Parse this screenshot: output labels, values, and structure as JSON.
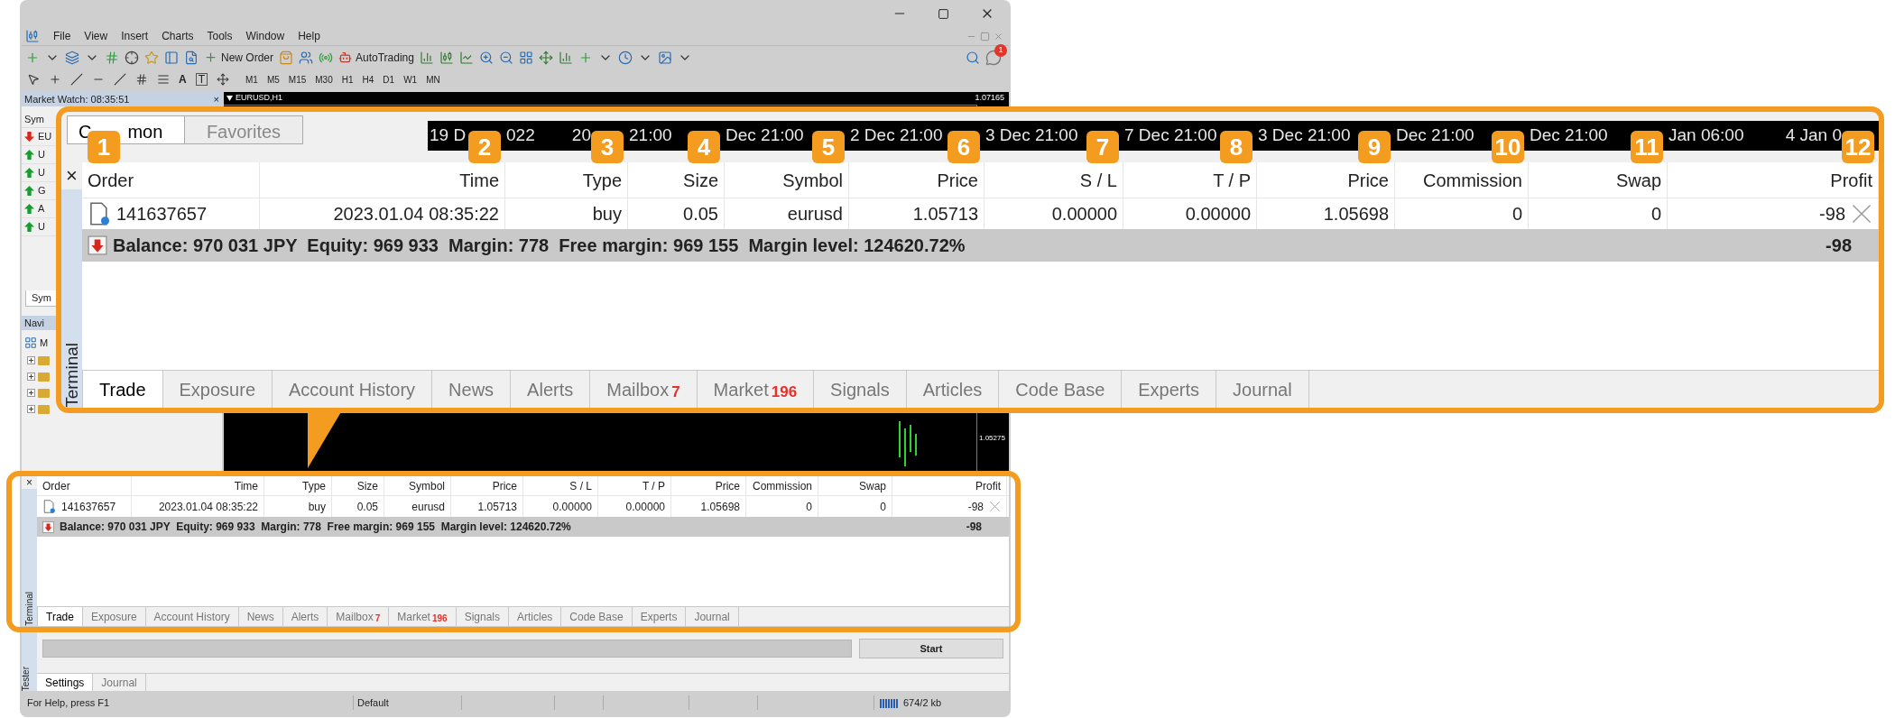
{
  "window": {
    "menu": [
      "File",
      "View",
      "Insert",
      "Charts",
      "Tools",
      "Window",
      "Help"
    ]
  },
  "toolbar": {
    "buttons": [
      {
        "label": "New Order"
      },
      {
        "label": "AutoTrading"
      }
    ],
    "notification_count": "1",
    "text_tool": "A",
    "label_tool": "T",
    "timeframes": [
      "M1",
      "M5",
      "M15",
      "M30",
      "H1",
      "H4",
      "D1",
      "W1",
      "MN"
    ]
  },
  "market_watch": {
    "title": "Market Watch: 08:35:51",
    "close": "×",
    "column": "Sym",
    "tab": "Sym",
    "symbols": [
      {
        "text": "EU",
        "kind": "down"
      },
      {
        "text": "U",
        "kind": "up"
      },
      {
        "text": "U",
        "kind": "up"
      },
      {
        "text": "G",
        "kind": "up"
      },
      {
        "text": "A",
        "kind": "up"
      },
      {
        "text": "U",
        "kind": "up"
      }
    ]
  },
  "navigator": {
    "title": "Navi",
    "root": "M",
    "children": [
      {
        "expanded": false
      },
      {
        "expanded": false
      },
      {
        "expanded": false
      },
      {
        "expanded": false
      }
    ]
  },
  "chart": {
    "title": "EURUSD,H1",
    "prices": [
      "1.07165",
      "1.05275"
    ]
  },
  "callout": {
    "panel_tabs": [
      {
        "label_start": "C",
        "label_end": "mon",
        "selected": true
      },
      {
        "label_start": "Favorites",
        "selected": false
      }
    ],
    "time_axis": [
      [
        "19 D"
      ],
      [
        "022",
        "20"
      ],
      [
        "21:00"
      ],
      [
        "Dec 21:00"
      ],
      [
        "2 Dec 21:00"
      ],
      [
        "3 Dec 21:00"
      ],
      [
        "7 Dec 21:00"
      ],
      [
        "3 Dec 21:00"
      ],
      [
        "Dec 21:00"
      ],
      [
        "Dec 21:00"
      ],
      [
        "Jan 06:00",
        "4 Jan 0"
      ]
    ],
    "terminal": {
      "close": "×",
      "side_label": "Terminal",
      "columns": [
        {
          "label": "Order",
          "marker": "1"
        },
        {
          "label": "Time",
          "marker": "2"
        },
        {
          "label": "Type",
          "marker": "3"
        },
        {
          "label": "Size",
          "marker": "4"
        },
        {
          "label": "Symbol",
          "marker": "5"
        },
        {
          "label": "Price",
          "marker": "6"
        },
        {
          "label": "S / L",
          "marker": "7"
        },
        {
          "label": "T / P",
          "marker": "8"
        },
        {
          "label": "Price",
          "marker": "9"
        },
        {
          "label": "Commission",
          "marker": "10"
        },
        {
          "label": "Swap",
          "marker": "11"
        },
        {
          "label": "Profit",
          "marker": "12"
        }
      ],
      "rows": [
        {
          "cells": [
            "141637657",
            "2023.01.04 08:35:22",
            "buy",
            "0.05",
            "eurusd",
            "1.05713",
            "0.00000",
            "0.00000",
            "1.05698",
            "0",
            "0",
            "-98"
          ],
          "closable": true
        }
      ],
      "summary": {
        "text": "Balance: 970 031 JPY  Equity: 969 933  Margin: 778  Free margin: 969 155  Margin level: 124620.72%",
        "profit": "-98"
      },
      "tabs": [
        {
          "label": "Trade",
          "selected": true
        },
        {
          "label": "Exposure",
          "selected": false
        },
        {
          "label": "Account History",
          "selected": false
        },
        {
          "label": "News",
          "selected": false
        },
        {
          "label": "Alerts",
          "selected": false
        },
        {
          "label": "Mailbox",
          "count": "7",
          "selected": false
        },
        {
          "label": "Market",
          "count": "196",
          "selected": false
        },
        {
          "label": "Signals",
          "selected": false
        },
        {
          "label": "Articles",
          "selected": false
        },
        {
          "label": "Code Base",
          "selected": false
        },
        {
          "label": "Experts",
          "selected": false
        },
        {
          "label": "Journal",
          "selected": false
        }
      ]
    }
  },
  "terminal": {
    "close": "×",
    "side_label": "Terminal",
    "columns": [
      {
        "label": "Order"
      },
      {
        "label": "Time"
      },
      {
        "label": "Type"
      },
      {
        "label": "Size"
      },
      {
        "label": "Symbol"
      },
      {
        "label": "Price"
      },
      {
        "label": "S / L"
      },
      {
        "label": "T / P"
      },
      {
        "label": "Price"
      },
      {
        "label": "Commission"
      },
      {
        "label": "Swap"
      },
      {
        "label": "Profit"
      }
    ],
    "rows": [
      {
        "cells": [
          "141637657",
          "2023.01.04 08:35:22",
          "buy",
          "0.05",
          "eurusd",
          "1.05713",
          "0.00000",
          "0.00000",
          "1.05698",
          "0",
          "0",
          "-98"
        ],
        "closable": true
      }
    ],
    "summary": {
      "text": "Balance: 970 031 JPY  Equity: 969 933  Margin: 778  Free margin: 969 155  Margin level: 124620.72%",
      "profit": "-98"
    },
    "tabs": [
      {
        "label": "Trade",
        "selected": true
      },
      {
        "label": "Exposure",
        "selected": false
      },
      {
        "label": "Account History",
        "selected": false
      },
      {
        "label": "News",
        "selected": false
      },
      {
        "label": "Alerts",
        "selected": false
      },
      {
        "label": "Mailbox",
        "count": "7",
        "selected": false
      },
      {
        "label": "Market",
        "count": "196",
        "selected": false
      },
      {
        "label": "Signals",
        "selected": false
      },
      {
        "label": "Articles",
        "selected": false
      },
      {
        "label": "Code Base",
        "selected": false
      },
      {
        "label": "Experts",
        "selected": false
      },
      {
        "label": "Journal",
        "selected": false
      }
    ]
  },
  "tester": {
    "side_label": "Tester",
    "progress": {
      "level": 0
    },
    "button": "Start",
    "tabs": [
      {
        "label": "Settings",
        "selected": true
      },
      {
        "label": "Journal",
        "selected": false
      }
    ]
  },
  "status_bar": {
    "help": "For Help, press F1",
    "profile": "Default",
    "traffic": "674/2 kb"
  }
}
